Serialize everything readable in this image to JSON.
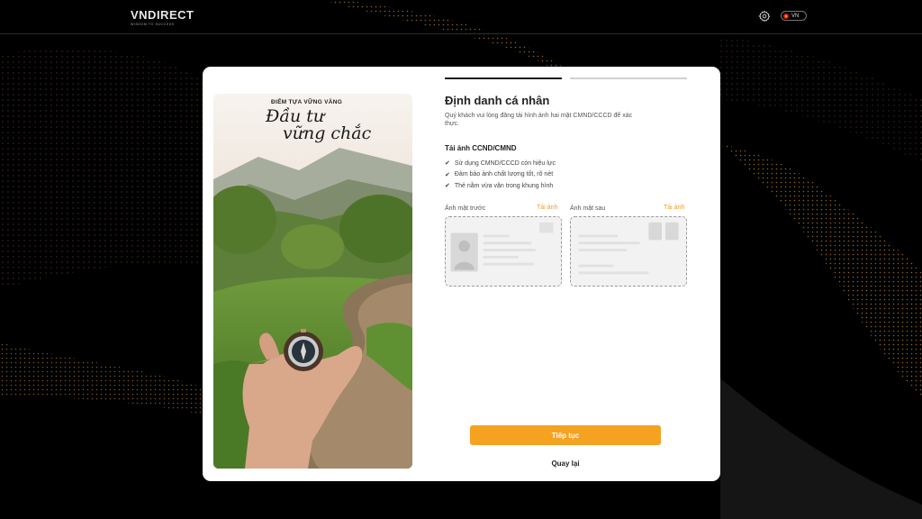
{
  "header": {
    "logo_text": "VNDIRECT",
    "logo_tagline": "WISDOM TO SUCCESS",
    "language_label": "VN"
  },
  "promo": {
    "slogan_top": "ĐIỂM TỰA VỮNG VÀNG",
    "slogan_line1": "Đầu tư",
    "slogan_line2": "vững chắc"
  },
  "form": {
    "title": "Định danh cá nhân",
    "subtitle": "Quý khách vui lòng đăng tải hình ảnh hai mặt CMND/CCCD để xác thực.",
    "section_title": "Tải ảnh CCND/CMND",
    "requirements": [
      "Sử dụng CMND/CCCD còn hiệu lực",
      "Đảm bảo ảnh chất lượng tốt, rõ nét",
      "Thẻ nằm vừa vặn trong khung hình"
    ],
    "front": {
      "label": "Ảnh mặt trước",
      "upload_link": "Tải ảnh"
    },
    "back": {
      "label": "Ảnh mặt sau",
      "upload_link": "Tải ảnh"
    },
    "continue_label": "Tiếp tục",
    "back_label": "Quay lại"
  },
  "icons": {
    "settings": "gear-icon",
    "flag": "vietnam-flag-icon",
    "check": "check-icon"
  },
  "colors": {
    "accent": "#f5a220",
    "link": "#f39a1e",
    "background": "#000000",
    "card": "#ffffff"
  }
}
